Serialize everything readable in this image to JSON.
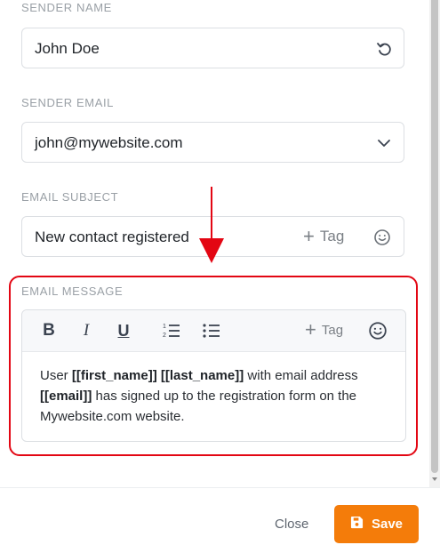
{
  "sender_name": {
    "label": "SENDER NAME",
    "value": "John Doe",
    "reset_icon": "undo-icon"
  },
  "sender_email": {
    "label": "SENDER EMAIL",
    "value": "john@mywebsite.com",
    "dropdown_icon": "chevron-down-icon"
  },
  "email_subject": {
    "label": "EMAIL SUBJECT",
    "value": "New contact registered",
    "tag_label": "Tag",
    "emoji_icon": "smiley-icon"
  },
  "email_message": {
    "label": "EMAIL MESSAGE",
    "toolbar": {
      "bold": "B",
      "italic": "I",
      "underline": "U",
      "tag_label": "Tag"
    },
    "body": {
      "t1": "User ",
      "first_name": "[[first_name]]",
      "t2": " ",
      "last_name": "[[last_name]]",
      "t3": " with email address ",
      "email": "[[email]]",
      "t4": " has signed up to the registration form on the Mywebsite.com website."
    }
  },
  "footer": {
    "close_label": "Close",
    "save_label": "Save"
  },
  "colors": {
    "accent": "#f47c0a",
    "highlight": "#e30613"
  }
}
